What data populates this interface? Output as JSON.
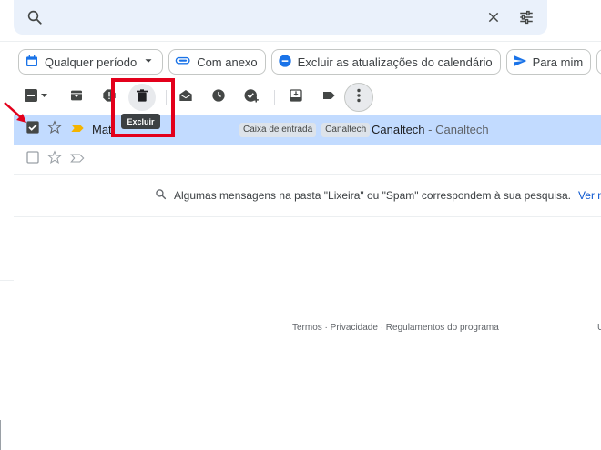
{
  "search": {
    "icon": "search-icon",
    "clear_icon": "close-icon",
    "options_icon": "tune-icon"
  },
  "chips": [
    {
      "label": "Qualquer período",
      "icon": "calendar-icon",
      "has_dropdown": true
    },
    {
      "label": "Com anexo",
      "icon": "paperclip-icon"
    },
    {
      "label": "Excluir as atualizações do calendário",
      "icon": "minus-circle-icon"
    },
    {
      "label": "Para mim",
      "icon": "send-icon"
    }
  ],
  "toolbar": {
    "select_all_icon": "checkbox-icon",
    "archive_icon": "archive-icon",
    "spam_icon": "report-spam-icon",
    "delete_icon": "trash-icon",
    "mark_read_icon": "mark-read-icon",
    "snooze_icon": "clock-icon",
    "add_task_icon": "add-task-icon",
    "move_icon": "move-to-inbox-icon",
    "label_icon": "label-icon",
    "more_icon": "more-vert-icon",
    "tooltip": "Excluir"
  },
  "messages": [
    {
      "sender": "Mat",
      "labels": [
        "Caixa de entrada",
        "Canaltech"
      ],
      "subject": "Canaltech",
      "snippet": " - Canaltech",
      "selected": true
    }
  ],
  "notice": {
    "text": "Algumas mensagens na pasta \"Lixeira\" ou \"Spam\" correspondem à sua pesquisa.",
    "link": "Ver mens"
  },
  "footer": {
    "links": "Termos · Privacidade · Regulamentos do programa",
    "right": "U"
  },
  "colors": {
    "search_bg": "#eaf1fb",
    "selected_row": "#c2dbff",
    "accent_blue": "#1a73e8",
    "highlight_red": "#e3001b",
    "important_yellow": "#f4b400"
  }
}
